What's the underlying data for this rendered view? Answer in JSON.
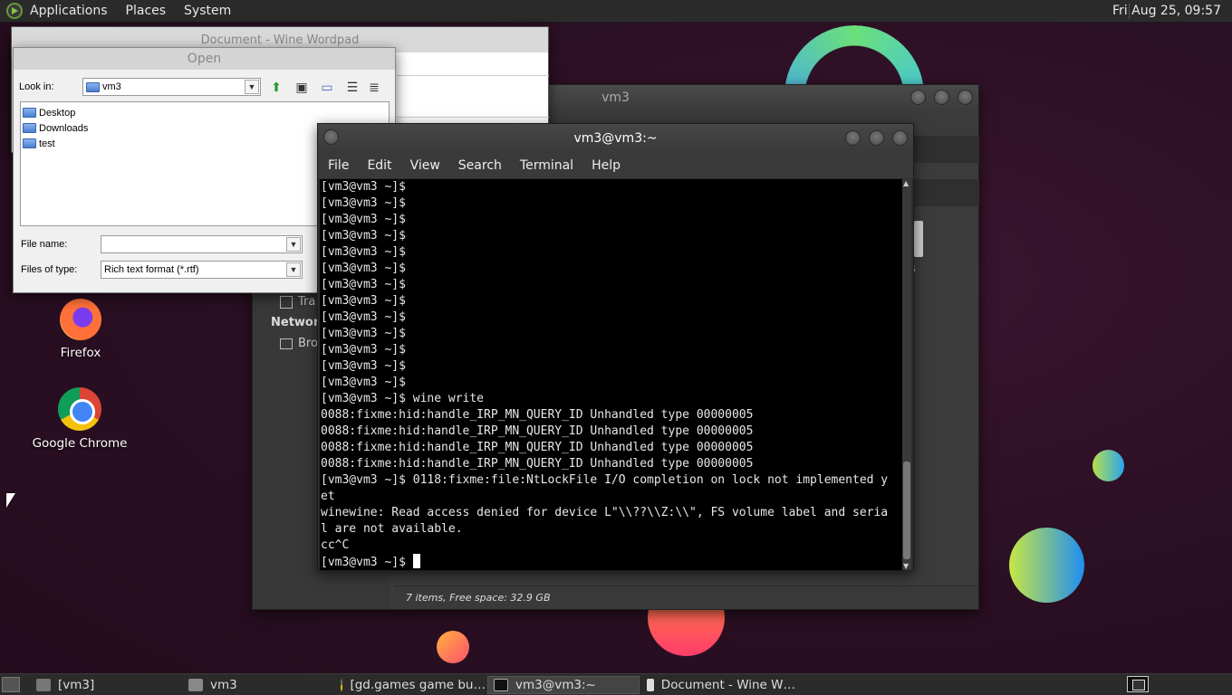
{
  "top_panel": {
    "menus": [
      "Applications",
      "Places",
      "System"
    ],
    "clock": "Fri Aug 25, 09:57"
  },
  "desktop_icons": [
    {
      "label": "Firefox",
      "icon": "firefox-icon"
    },
    {
      "label": "Google Chrome",
      "icon": "chrome-icon"
    }
  ],
  "file_manager": {
    "title": "vm3",
    "sidebar": {
      "trash_label": "Tra",
      "network_heading": "Network",
      "browse_label": "Bro"
    },
    "status": "7 items, Free space: 32.9 GB",
    "partial_label": "s"
  },
  "wordpad": {
    "title": "Document - Wine Wordpad"
  },
  "open_dialog": {
    "title": "Open",
    "look_in_label": "Look in:",
    "look_in_value": "vm3",
    "items": [
      "Desktop",
      "Downloads",
      "test"
    ],
    "file_name_label": "File name:",
    "file_name_value": "",
    "file_type_label": "Files of type:",
    "file_type_value": "Rich text format (*.rtf)"
  },
  "terminal": {
    "title": "vm3@vm3:~",
    "menus": [
      "File",
      "Edit",
      "View",
      "Search",
      "Terminal",
      "Help"
    ],
    "lines": [
      "[vm3@vm3 ~]$",
      "[vm3@vm3 ~]$",
      "[vm3@vm3 ~]$",
      "[vm3@vm3 ~]$",
      "[vm3@vm3 ~]$",
      "[vm3@vm3 ~]$",
      "[vm3@vm3 ~]$",
      "[vm3@vm3 ~]$",
      "[vm3@vm3 ~]$",
      "[vm3@vm3 ~]$",
      "[vm3@vm3 ~]$",
      "[vm3@vm3 ~]$",
      "[vm3@vm3 ~]$",
      "[vm3@vm3 ~]$ wine write",
      "0088:fixme:hid:handle_IRP_MN_QUERY_ID Unhandled type 00000005",
      "0088:fixme:hid:handle_IRP_MN_QUERY_ID Unhandled type 00000005",
      "0088:fixme:hid:handle_IRP_MN_QUERY_ID Unhandled type 00000005",
      "0088:fixme:hid:handle_IRP_MN_QUERY_ID Unhandled type 00000005",
      "[vm3@vm3 ~]$ 0118:fixme:file:NtLockFile I/O completion on lock not implemented y",
      "et",
      "winewine: Read access denied for device L\"\\\\??\\\\Z:\\\\\", FS volume label and seria",
      "l are not available.",
      "cc^C"
    ],
    "prompt": "[vm3@vm3 ~]$ "
  },
  "taskbar": {
    "tasks": [
      {
        "label": "[vm3]",
        "icon": "folder-icon"
      },
      {
        "label": "vm3",
        "icon": "home-folder-icon"
      },
      {
        "label": "[gd.games game bu…",
        "icon": "chrome-icon"
      },
      {
        "label": "vm3@vm3:~",
        "icon": "terminal-icon"
      },
      {
        "label": "Document - Wine W…",
        "icon": "wordpad-icon"
      }
    ]
  }
}
